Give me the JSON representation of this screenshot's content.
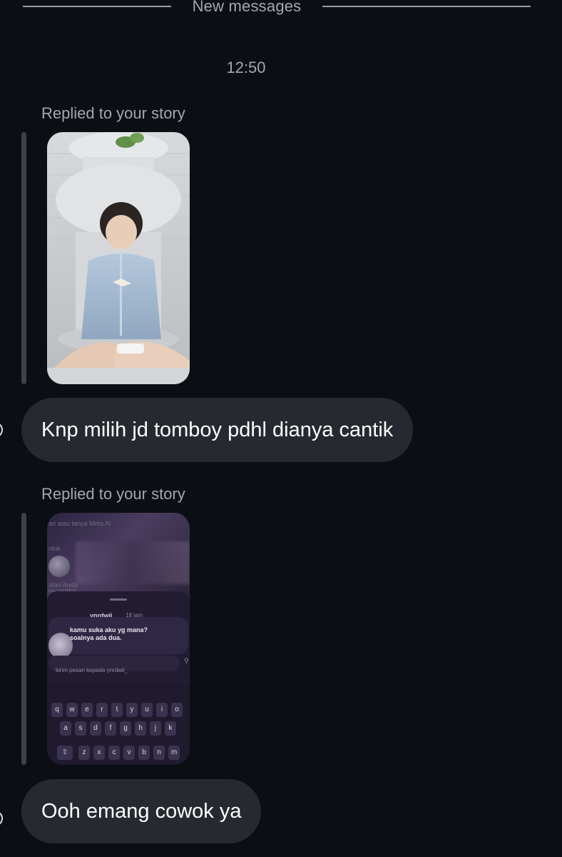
{
  "divider": {
    "label": "New messages"
  },
  "timestamp": "12:50",
  "messages": [
    {
      "replied_label": "Replied to your story",
      "text": "Knp milih jd tomboy pdhl dianya cantik"
    },
    {
      "replied_label": "Replied to your story",
      "text": "Ooh emang cowok ya",
      "story_screen": {
        "top_hint": "ari atau tanya Meta AI",
        "top_left": "ntuk",
        "side_label": "atan Anda",
        "side_sub": "kau nanakul",
        "username": "ynrdwii_",
        "time": "18 jam",
        "message_line1": "kamu suka aku yg mana?",
        "message_line2": "soalnya ada dua.",
        "input_placeholder": "kirim pesan kepada ynrdwii_",
        "keyboard_row1": [
          "q",
          "w",
          "e",
          "r",
          "t",
          "y",
          "u",
          "i",
          "o"
        ],
        "keyboard_row2": [
          "a",
          "s",
          "d",
          "f",
          "g",
          "h",
          "j",
          "k"
        ],
        "keyboard_row3": [
          "⇧",
          "z",
          "x",
          "c",
          "v",
          "b",
          "n",
          "m"
        ]
      }
    }
  ],
  "colors": {
    "background": "#0b0e13",
    "bubble": "#262a30",
    "muted_text": "#a3a8b0"
  }
}
